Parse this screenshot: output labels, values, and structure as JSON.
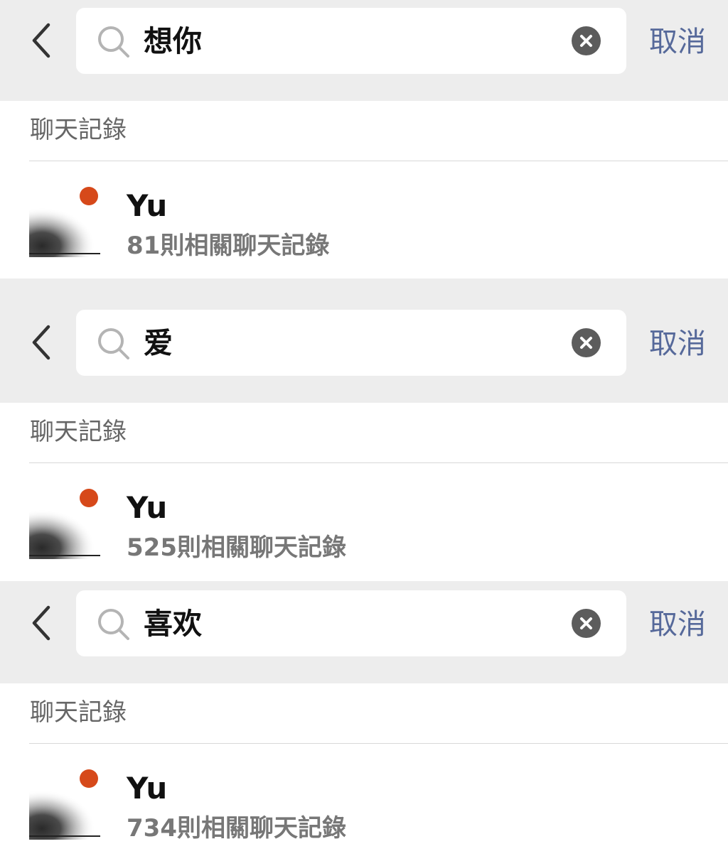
{
  "searches": [
    {
      "query": "想你",
      "cancel_label": "取消",
      "section_title": "聊天記錄",
      "result": {
        "name": "Yu",
        "summary": "81則相關聊天記錄"
      }
    },
    {
      "query": "爱",
      "cancel_label": "取消",
      "section_title": "聊天記錄",
      "result": {
        "name": "Yu",
        "summary": "525則相關聊天記錄"
      }
    },
    {
      "query": "喜欢",
      "cancel_label": "取消",
      "section_title": "聊天記錄",
      "result": {
        "name": "Yu",
        "summary": "734則相關聊天記錄"
      }
    }
  ],
  "icons": {
    "back": "chevron-left-icon",
    "search": "magnifier-icon",
    "clear": "clear-x-icon",
    "avatar": "dot-avatar-icon"
  },
  "colors": {
    "background": "#ededed",
    "card": "#ffffff",
    "accent": "#56699a",
    "avatar_dot": "#d6491a"
  }
}
